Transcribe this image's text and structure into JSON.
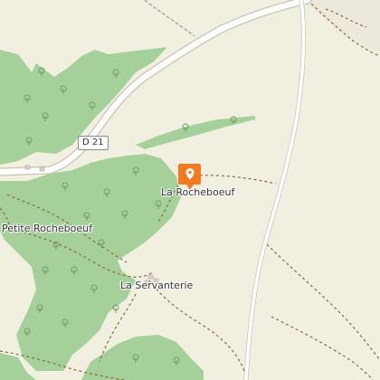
{
  "map": {
    "background_color": "#f1efdf",
    "forest_color": "#a6d09a",
    "road_color": "#ffffff",
    "path_color": "#8a6a3e"
  },
  "road_ref": "D 21",
  "marker": {
    "icon": "location-pin-icon",
    "color": "#f47a20",
    "label": "La Rocheboeuf"
  },
  "places": [
    {
      "name": "Petite Rocheboeuf"
    },
    {
      "name": "La Servanterie"
    }
  ]
}
